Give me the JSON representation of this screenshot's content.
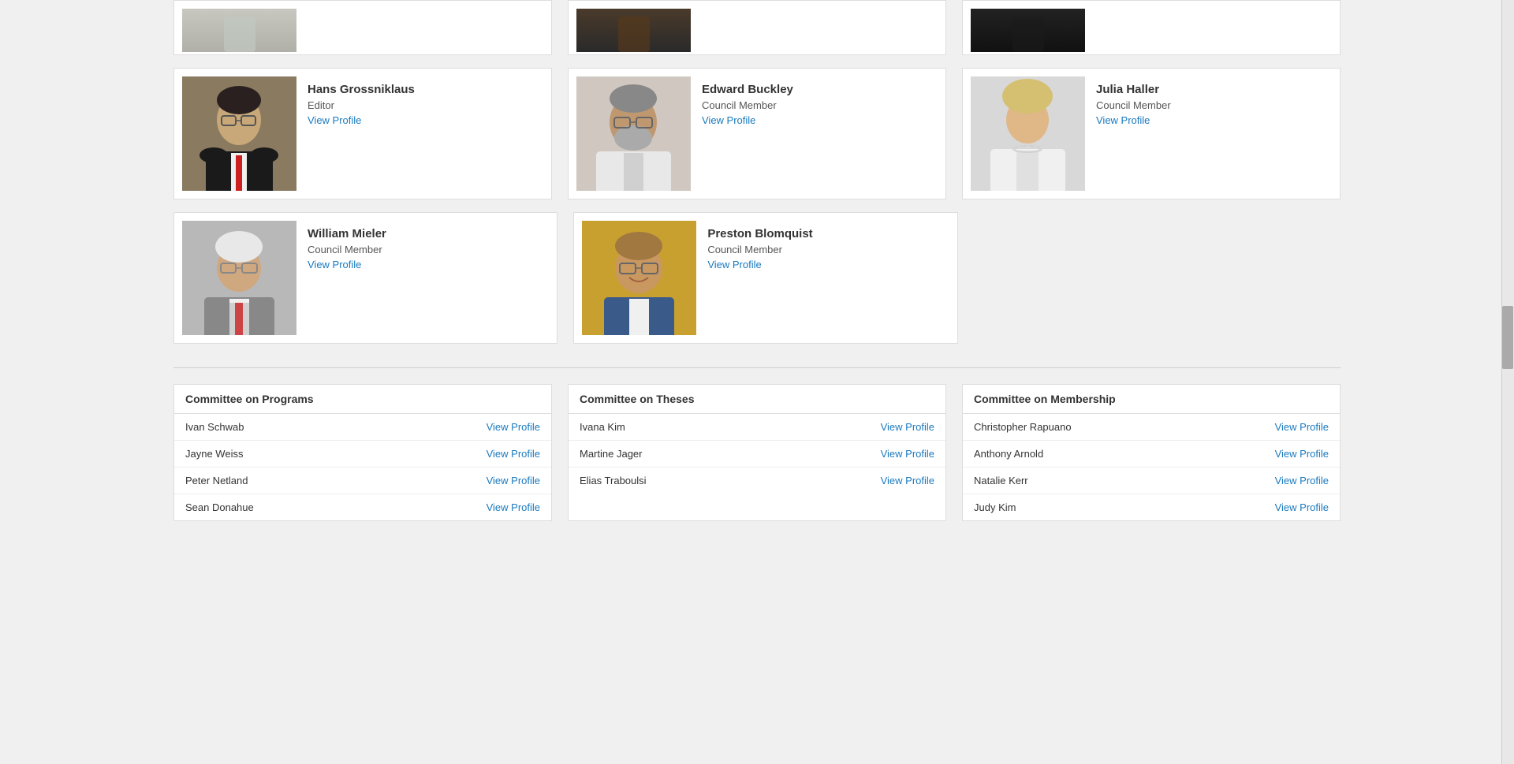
{
  "topPartialRow": [
    {
      "id": "partial-person-1",
      "photoBg": "#a0a8a0",
      "photoDesc": "Woman in light gray suit - partial view"
    },
    {
      "id": "partial-person-2",
      "photoBg": "#2a2a2a",
      "photoDesc": "Man in suit with red tie - partial view"
    },
    {
      "id": "partial-person-3",
      "photoBg": "#1a1a1a",
      "photoDesc": "Man in dark suit - partial view"
    }
  ],
  "councilMembers": [
    {
      "id": "hans-grossniklaus",
      "name": "Hans Grossniklaus",
      "role": "Editor",
      "viewProfileLabel": "View Profile",
      "viewProfileUrl": "#",
      "photoBg": "#6a5a4a",
      "photoHint": "Man with glasses, dark suit, red tie"
    },
    {
      "id": "edward-buckley",
      "name": "Edward Buckley",
      "role": "Council Member",
      "viewProfileLabel": "View Profile",
      "viewProfileUrl": "#",
      "photoBg": "#c8c0b8",
      "photoHint": "Older man with beard wearing white coat"
    },
    {
      "id": "julia-haller",
      "name": "Julia Haller",
      "role": "Council Member",
      "viewProfileLabel": "View Profile",
      "viewProfileUrl": "#",
      "photoBg": "#d8d0c8",
      "photoHint": "Woman with light hair, white coat with pearls"
    }
  ],
  "councilMembers2": [
    {
      "id": "william-mieler",
      "name": "William Mieler",
      "role": "Council Member",
      "viewProfileLabel": "View Profile",
      "viewProfileUrl": "#",
      "photoBg": "#b0b0b0",
      "photoHint": "Older man with white hair and glasses, gray suit"
    },
    {
      "id": "preston-blomquist",
      "name": "Preston Blomquist",
      "role": "Council Member",
      "viewProfileLabel": "View Profile",
      "viewProfileUrl": "#",
      "photoBg": "#c8a040",
      "photoHint": "Man with glasses smiling, tan/gold background"
    }
  ],
  "committees": [
    {
      "id": "committee-programs",
      "title": "Committee on Programs",
      "members": [
        {
          "name": "Ivan Schwab",
          "viewProfileLabel": "View Profile",
          "url": "#"
        },
        {
          "name": "Jayne Weiss",
          "viewProfileLabel": "View Profile",
          "url": "#"
        },
        {
          "name": "Peter Netland",
          "viewProfileLabel": "View Profile",
          "url": "#"
        },
        {
          "name": "Sean Donahue",
          "viewProfileLabel": "View Profile",
          "url": "#"
        }
      ]
    },
    {
      "id": "committee-theses",
      "title": "Committee on Theses",
      "members": [
        {
          "name": "Ivana Kim",
          "viewProfileLabel": "View Profile",
          "url": "#"
        },
        {
          "name": "Martine Jager",
          "viewProfileLabel": "View Profile",
          "url": "#"
        },
        {
          "name": "Elias Traboulsi",
          "viewProfileLabel": "View Profile",
          "url": "#"
        }
      ]
    },
    {
      "id": "committee-membership",
      "title": "Committee on Membership",
      "members": [
        {
          "name": "Christopher Rapuano",
          "viewProfileLabel": "View Profile",
          "url": "#"
        },
        {
          "name": "Anthony Arnold",
          "viewProfileLabel": "View Profile",
          "url": "#"
        },
        {
          "name": "Natalie Kerr",
          "viewProfileLabel": "View Profile",
          "url": "#"
        },
        {
          "name": "Judy Kim",
          "viewProfileLabel": "View Profile",
          "url": "#"
        }
      ]
    }
  ]
}
